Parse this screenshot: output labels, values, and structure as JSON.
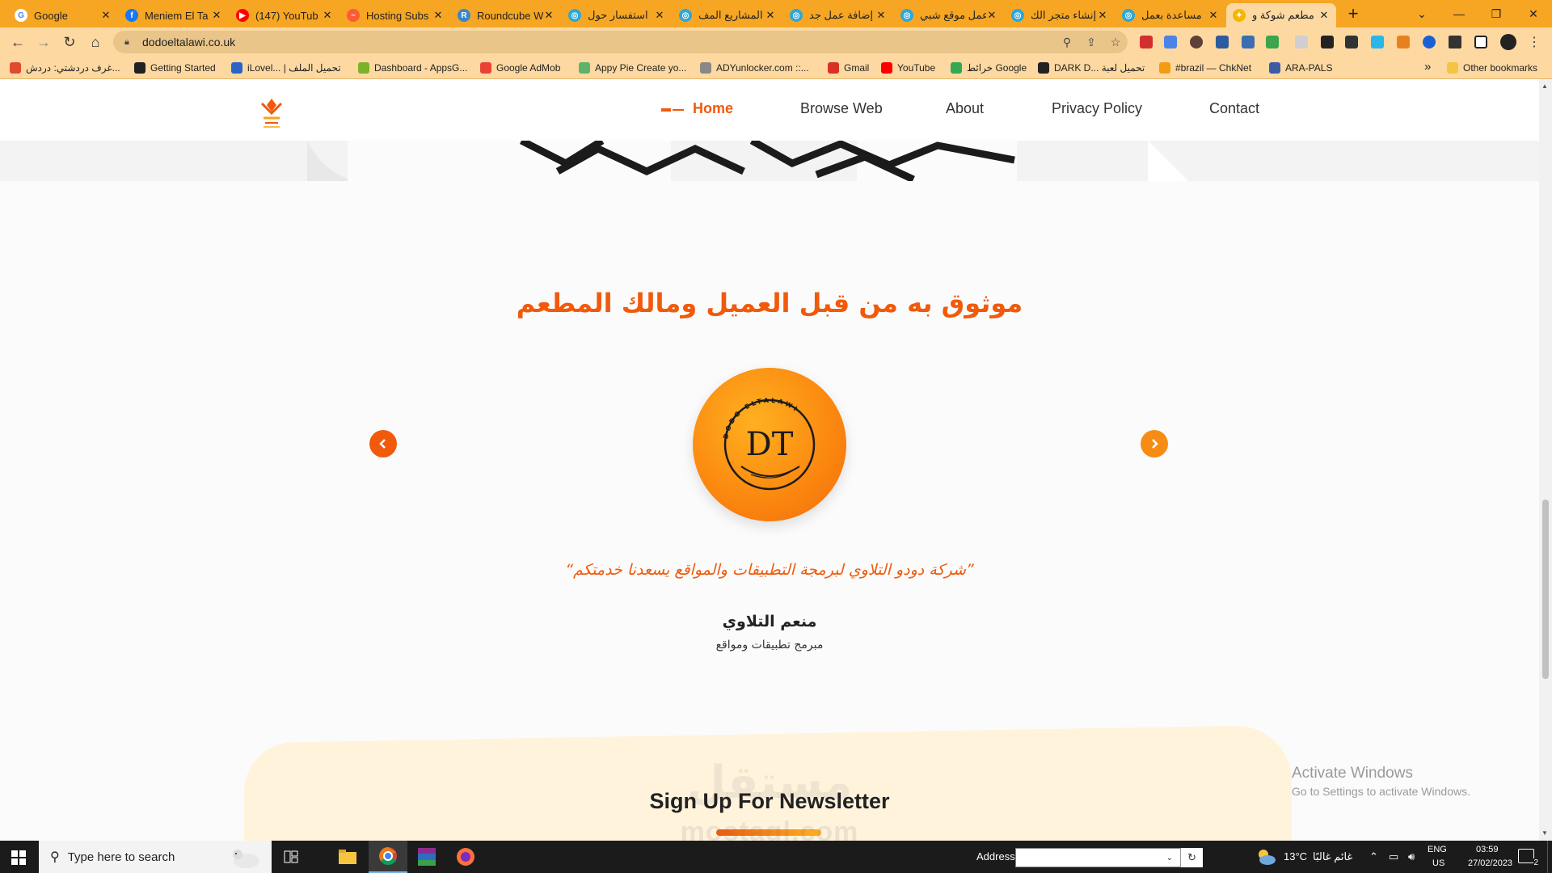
{
  "browser": {
    "tabs": [
      {
        "title": "Google",
        "favicon": "google-icon",
        "color": "#ffffff",
        "glyph": "G"
      },
      {
        "title": "Meniem El Ta",
        "favicon": "facebook-icon",
        "color": "#1877f2",
        "glyph": "f"
      },
      {
        "title": "(147) YouTub",
        "favicon": "youtube-icon",
        "color": "#ff0000",
        "glyph": "▶"
      },
      {
        "title": "Hosting Subs",
        "favicon": "hosting-icon",
        "color": "#ff5a36",
        "glyph": "~"
      },
      {
        "title": "Roundcube W",
        "favicon": "roundcube-icon",
        "color": "#3a87c8",
        "glyph": "R"
      },
      {
        "title": "استفسار حول",
        "favicon": "mostaql-icon",
        "color": "#2ea7d6",
        "glyph": "◎"
      },
      {
        "title": "المشاريع المف",
        "favicon": "mostaql-icon",
        "color": "#2ea7d6",
        "glyph": "◎"
      },
      {
        "title": "إضافة عمل جد",
        "favicon": "mostaql-icon",
        "color": "#2ea7d6",
        "glyph": "◎"
      },
      {
        "title": "عمل موقع شبي",
        "favicon": "mostaql-icon",
        "color": "#2ea7d6",
        "glyph": "◎"
      },
      {
        "title": "إنشاء متجر الك",
        "favicon": "mostaql-icon",
        "color": "#2ea7d6",
        "glyph": "◎"
      },
      {
        "title": "مساعدة بعمل",
        "favicon": "mostaql-icon",
        "color": "#2ea7d6",
        "glyph": "◎"
      },
      {
        "title": "مطعم شوكة و",
        "favicon": "fork-knife-icon",
        "color": "#f7b500",
        "glyph": "✦"
      }
    ],
    "new_tab": "+",
    "window_controls": {
      "tabsearch": "⌄",
      "minimize": "—",
      "restore": "❐",
      "close": "✕"
    },
    "url": "dodoeltalawi.co.uk",
    "bookmarks": [
      {
        "label": "غرف دردشتي: دردش...",
        "color": "#e04a2f"
      },
      {
        "label": "Getting Started",
        "color": "#222222"
      },
      {
        "label": "iLovel... | تحميل الملف",
        "color": "#2b63c9"
      },
      {
        "label": "Dashboard - AppsG...",
        "color": "#7cb12b"
      },
      {
        "label": "Google AdMob",
        "color": "#ea4335"
      },
      {
        "label": "Appy Pie Create yo...",
        "color": "#5db36b"
      },
      {
        "label": "ADYunlocker.com ::...",
        "color": "#888888"
      },
      {
        "label": "Gmail",
        "color": "#d93025"
      },
      {
        "label": "YouTube",
        "color": "#ff0000"
      },
      {
        "label": "خرائط Google",
        "color": "#34a853"
      },
      {
        "label": "DARK D... تحميل لعبة",
        "color": "#222222"
      },
      {
        "label": "#brazil — ChkNet",
        "color": "#f39c12"
      },
      {
        "label": "ARA-PALS",
        "color": "#3b5ba5"
      }
    ],
    "bookmarks_more": "»",
    "other_bookmarks": "Other bookmarks"
  },
  "site": {
    "nav": {
      "home": "Home",
      "browse": "Browse Web",
      "about": "About",
      "privacy": "Privacy Policy",
      "contact": "Contact"
    },
    "accent": "#f15a0b",
    "testimonials": {
      "title": "موثوق به من قبل العميل ومالك المطعم",
      "quote": "”شركة دودو التلاوي لبرمجة التطبيقات والمواقع يسعدنا خدمتكم“",
      "name": "منعم التلاوي",
      "role": "مبرمج تطبيقات ومواقع",
      "avatar_ring_text": "DODO ELTALAWI",
      "avatar_monogram": "DT"
    },
    "newsletter": {
      "title": "Sign Up For Newsletter"
    },
    "watermark": {
      "arabic": "مستقل",
      "latin": "mostaql.com"
    }
  },
  "windows": {
    "activate_title": "Activate Windows",
    "activate_sub": "Go to Settings to activate Windows.",
    "search_placeholder": "Type here to search",
    "address_label": "Address",
    "weather_temp": "13°C",
    "weather_desc": "غائم غالبًا",
    "lang_top": "ENG",
    "lang_bottom": "US",
    "time": "03:59",
    "date": "27/02/2023",
    "notifications": "2"
  }
}
